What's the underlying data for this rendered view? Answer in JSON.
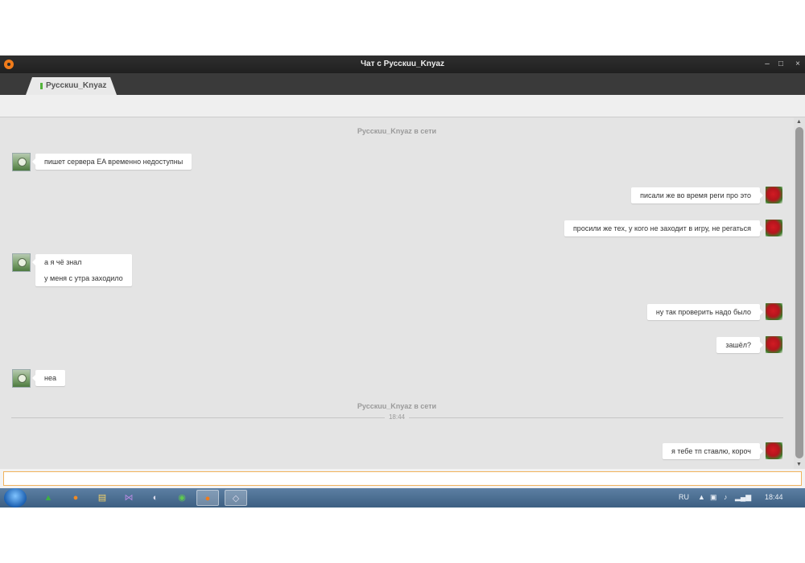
{
  "window": {
    "title": "Чат с Pусскuu_Knyaz",
    "minimize_glyph": "–",
    "maximize_glyph": "□",
    "close_glyph": "×"
  },
  "tab": {
    "label": "Pусскuu_Knyaz"
  },
  "chat": {
    "status_online_1": "Pусскuu_Knyaz в сети",
    "status_online_2": "Pусскuu_Knyaz в сети",
    "divider_time": "18:44",
    "messages": [
      {
        "side": "left",
        "lines": [
          "пишет сервера EA временно недоступны"
        ]
      },
      {
        "side": "right",
        "lines": [
          "писали же во время реги про это"
        ]
      },
      {
        "side": "right",
        "lines": [
          "просили же тех, у кого не заходит в игру, не регаться"
        ]
      },
      {
        "side": "left",
        "lines": [
          "а я чё знал",
          "у меня с утра заходило"
        ]
      },
      {
        "side": "right",
        "lines": [
          "ну так проверить надо было"
        ]
      },
      {
        "side": "right",
        "lines": [
          "зашёл?"
        ]
      },
      {
        "side": "left",
        "lines": [
          "неа"
        ]
      },
      {
        "side": "right",
        "lines": [
          "я тебе тп ставлю, короч"
        ]
      }
    ]
  },
  "input": {
    "value": "",
    "placeholder": ""
  },
  "scrollbar": {
    "up_glyph": "▲",
    "down_glyph": "▼"
  },
  "taskbar": {
    "language": "RU",
    "clock": "18:44",
    "tray_glyphs": [
      "▲",
      "▣",
      "♪",
      "▂▄▆"
    ]
  },
  "icons": {
    "app": "app-logo-icon",
    "start": "windows-start-icon",
    "taskbar": [
      "agent-icon",
      "firefox-icon",
      "explorer-icon",
      "visual-studio-icon",
      "speaker-icon",
      "utorrent-icon",
      "chat-app-icon",
      "antivirus-icon"
    ]
  }
}
